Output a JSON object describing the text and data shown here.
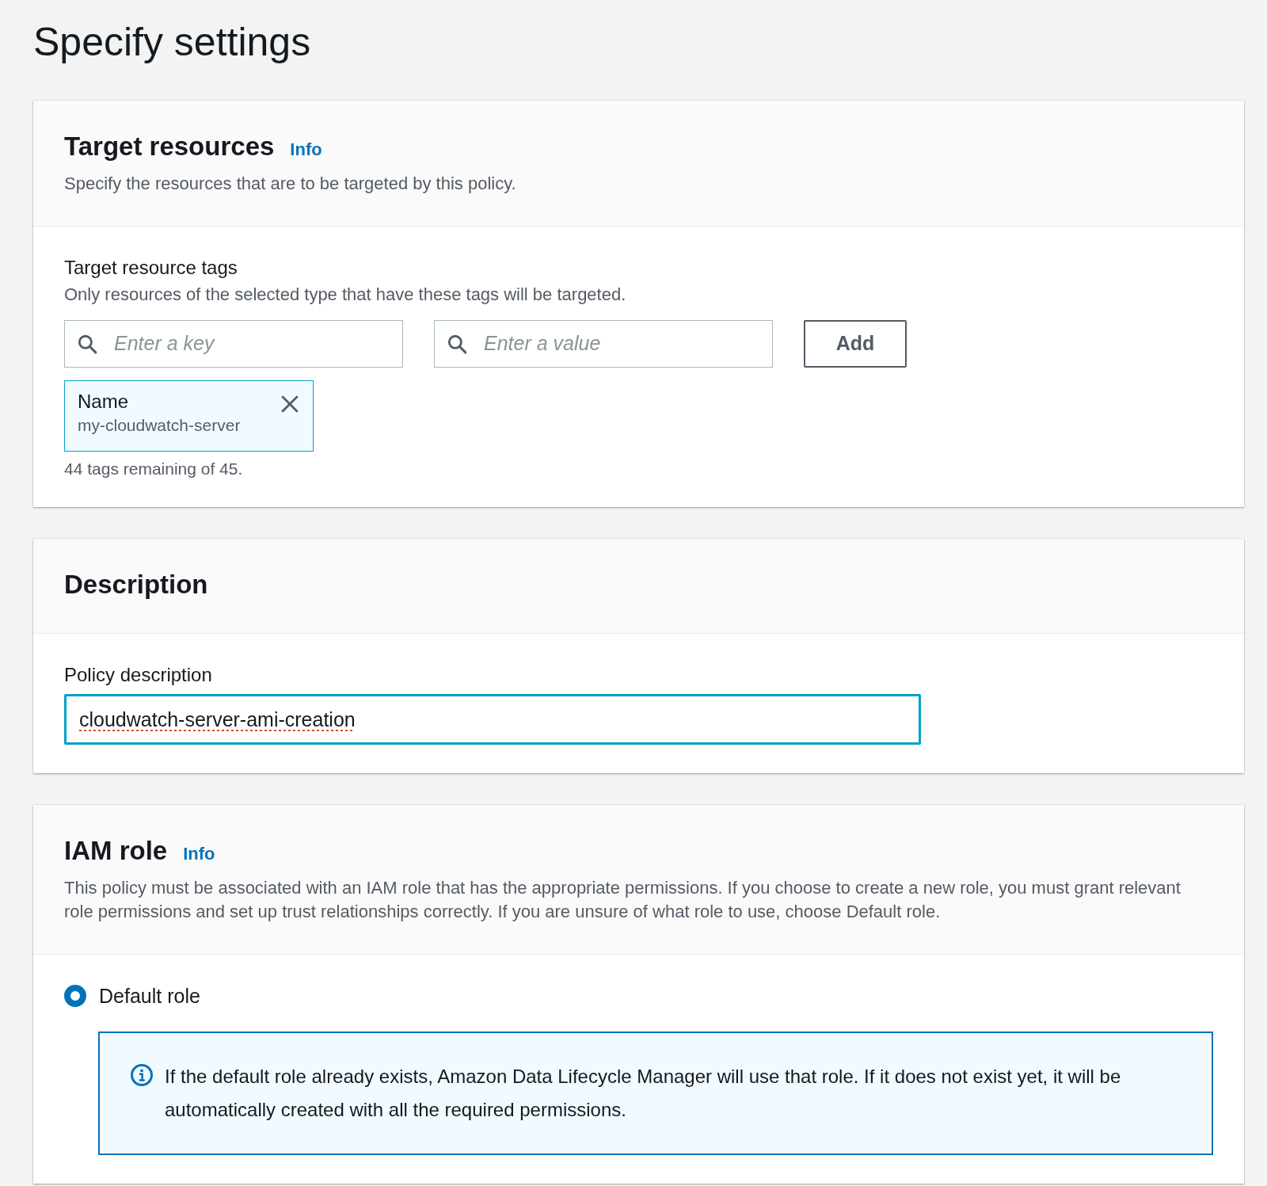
{
  "page_title": "Specify settings",
  "target_resources": {
    "title": "Target resources",
    "info_link": "Info",
    "description": "Specify the resources that are to be targeted by this policy.",
    "tags_label": "Target resource tags",
    "tags_hint": "Only resources of the selected type that have these tags will be targeted.",
    "key_field": {
      "placeholder": "Enter a key"
    },
    "value_field": {
      "placeholder": "Enter a value"
    },
    "add_button": "Add",
    "tags": [
      {
        "key": "Name",
        "value": "my-cloudwatch-server"
      }
    ],
    "remaining": "44 tags remaining of 45."
  },
  "description_section": {
    "title": "Description",
    "field_label": "Policy description",
    "field": {
      "value": "cloudwatch-server-ami-creation",
      "focused": true
    }
  },
  "iam_role": {
    "title": "IAM role",
    "info_link": "Info",
    "description": "This policy must be associated with an IAM role that has the appropriate permissions. If you choose to create a new role, you must grant relevant role permissions and set up trust relationships correctly. If you are unsure of what role to use, choose Default role.",
    "options": [
      {
        "label": "Default role",
        "selected": true
      }
    ],
    "alert": "If the default role already exists, Amazon Data Lifecycle Manager will use that role. If it does not exist yet, it will be automatically created with all the required permissions."
  }
}
